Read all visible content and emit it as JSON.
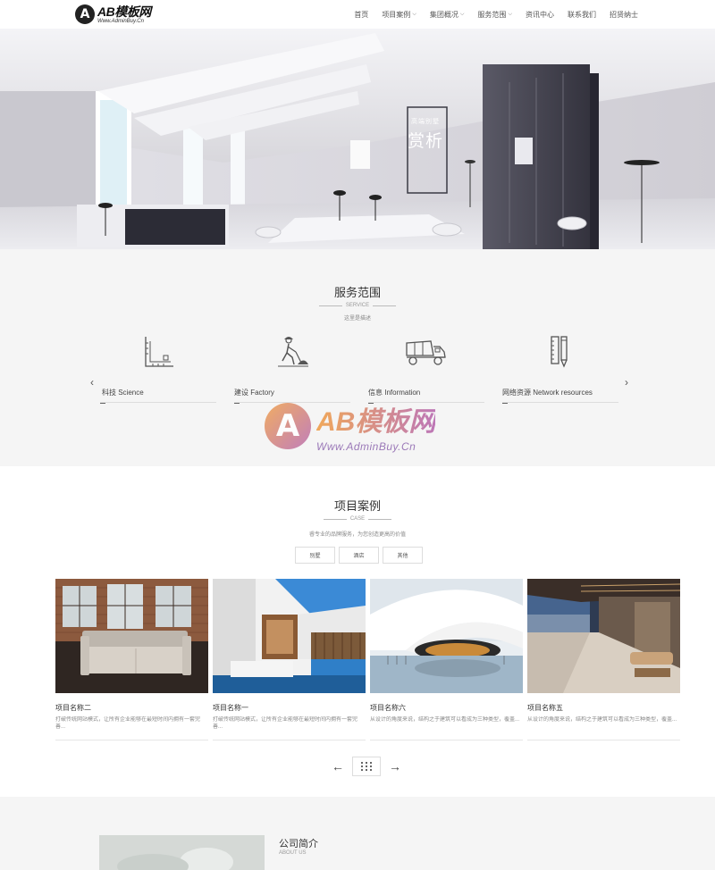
{
  "brand": {
    "logo_letter": "A",
    "logo_main": "AB模板网",
    "logo_sub": "Www.AdminBuy.Cn"
  },
  "nav": {
    "items": [
      {
        "label": "首页",
        "has_dropdown": false
      },
      {
        "label": "项目案例",
        "has_dropdown": true
      },
      {
        "label": "集团概况",
        "has_dropdown": true
      },
      {
        "label": "服务范围",
        "has_dropdown": true
      },
      {
        "label": "资讯中心",
        "has_dropdown": false
      },
      {
        "label": "联系我们",
        "has_dropdown": false
      },
      {
        "label": "招贤纳士",
        "has_dropdown": false
      }
    ],
    "caret_icon": "chevron-down-icon"
  },
  "hero": {
    "caption_small": "高端别墅",
    "caption_big": "赏析"
  },
  "services": {
    "title": "服务范围",
    "subtitle": "SERVICE",
    "description": "这里是描述",
    "prev_arrow": "‹",
    "next_arrow": "›",
    "items": [
      {
        "label": "科技 Science",
        "icon": "ruler-triangle-icon"
      },
      {
        "label": "建设 Factory",
        "icon": "construction-worker-icon"
      },
      {
        "label": "信息 Information",
        "icon": "dump-truck-icon"
      },
      {
        "label": "网络资源 Network resources",
        "icon": "ruler-pencil-icon"
      }
    ]
  },
  "watermark": {
    "letter": "A",
    "main": "AB模板网",
    "sub": "Www.AdminBuy.Cn"
  },
  "cases": {
    "title": "项目案例",
    "subtitle": "CASE",
    "description": "睿专业的品牌服务，为您创造更高的价值",
    "tabs": [
      "别墅",
      "酒店",
      "其他"
    ],
    "items": [
      {
        "name": "项目名称二",
        "text": "打破传统网站模式，让所有企业能够在最短时间内拥有一套完善..."
      },
      {
        "name": "项目名称一",
        "text": "打破传统网站模式，让所有企业能够在最短时间内拥有一套完善..."
      },
      {
        "name": "项目名称六",
        "text": "从设计的角度来说，结构之于建筑可以看成为三种类型，覆盖..."
      },
      {
        "name": "项目名称五",
        "text": "从设计的角度来说，结构之于建筑可以看成为三种类型，覆盖..."
      }
    ],
    "pager_prev": "←",
    "pager_next": "→"
  },
  "about": {
    "title": "公司简介",
    "subtitle": "ABOUT US"
  }
}
